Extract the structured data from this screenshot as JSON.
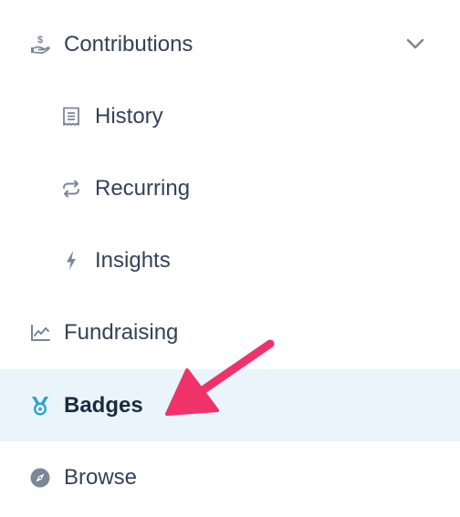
{
  "nav": {
    "contributions": {
      "label": "Contributions",
      "icon": "hand-dollar-icon",
      "expanded": true,
      "children": [
        {
          "label": "History",
          "icon": "receipt-icon"
        },
        {
          "label": "Recurring",
          "icon": "repeat-icon"
        },
        {
          "label": "Insights",
          "icon": "bolt-icon"
        }
      ]
    },
    "fundraising": {
      "label": "Fundraising",
      "icon": "chart-line-icon"
    },
    "badges": {
      "label": "Badges",
      "icon": "medal-icon",
      "active": true
    },
    "browse": {
      "label": "Browse",
      "icon": "compass-icon"
    }
  },
  "colors": {
    "text": "#33425a",
    "active_text": "#1c2a40",
    "icon": "#7b8798",
    "active_background": "#eaf5fb",
    "active_icon": "#2ba2c9",
    "annotation_arrow": "#f0326b"
  }
}
